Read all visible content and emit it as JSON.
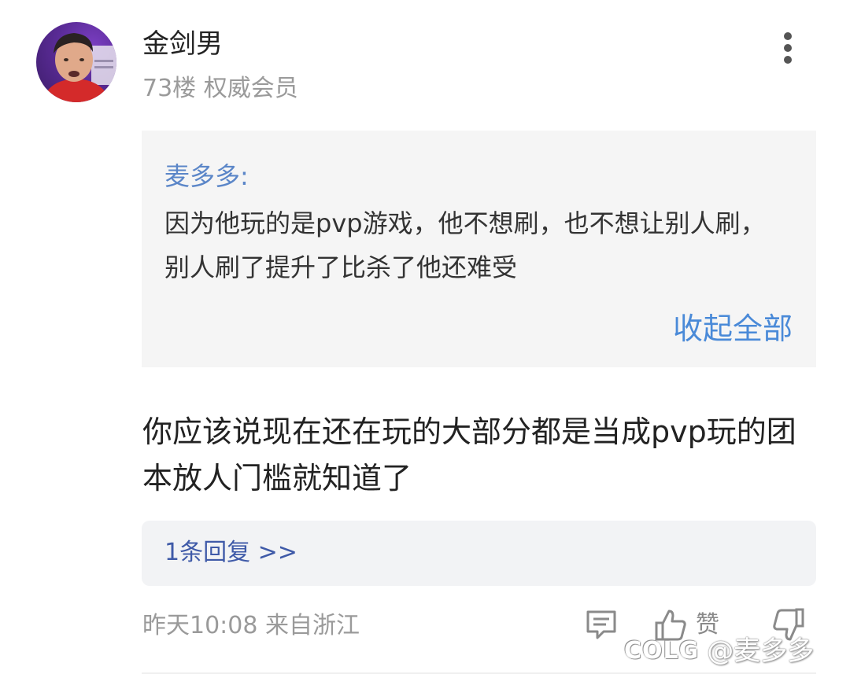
{
  "post": {
    "username": "金剑男",
    "meta": "73楼 权威会员",
    "quote": {
      "author": "麦多多:",
      "text": "因为他玩的是pvp游戏，他不想刷，也不想让别人刷，别人刷了提升了比杀了他还难受",
      "collapse_label": "收起全部"
    },
    "content": "你应该说现在还在玩的大部分都是当成pvp玩的团本放人门槛就知道了",
    "replies_label": "1条回复 >>",
    "time": "昨天10:08 来自浙江",
    "like_label": "赞",
    "watermark": {
      "logo": "COLG",
      "handle": "@麦多多"
    }
  },
  "icons": {
    "more": "more-vertical-icon",
    "comment": "comment-icon",
    "like": "thumbs-up-icon",
    "dislike": "thumbs-down-icon"
  },
  "colors": {
    "quote_author": "#5b86c8",
    "collapse": "#4a8ad8",
    "reply_link": "#3f5aa8",
    "quote_bg": "#f5f5f5",
    "reply_bg": "#f2f3f5"
  }
}
